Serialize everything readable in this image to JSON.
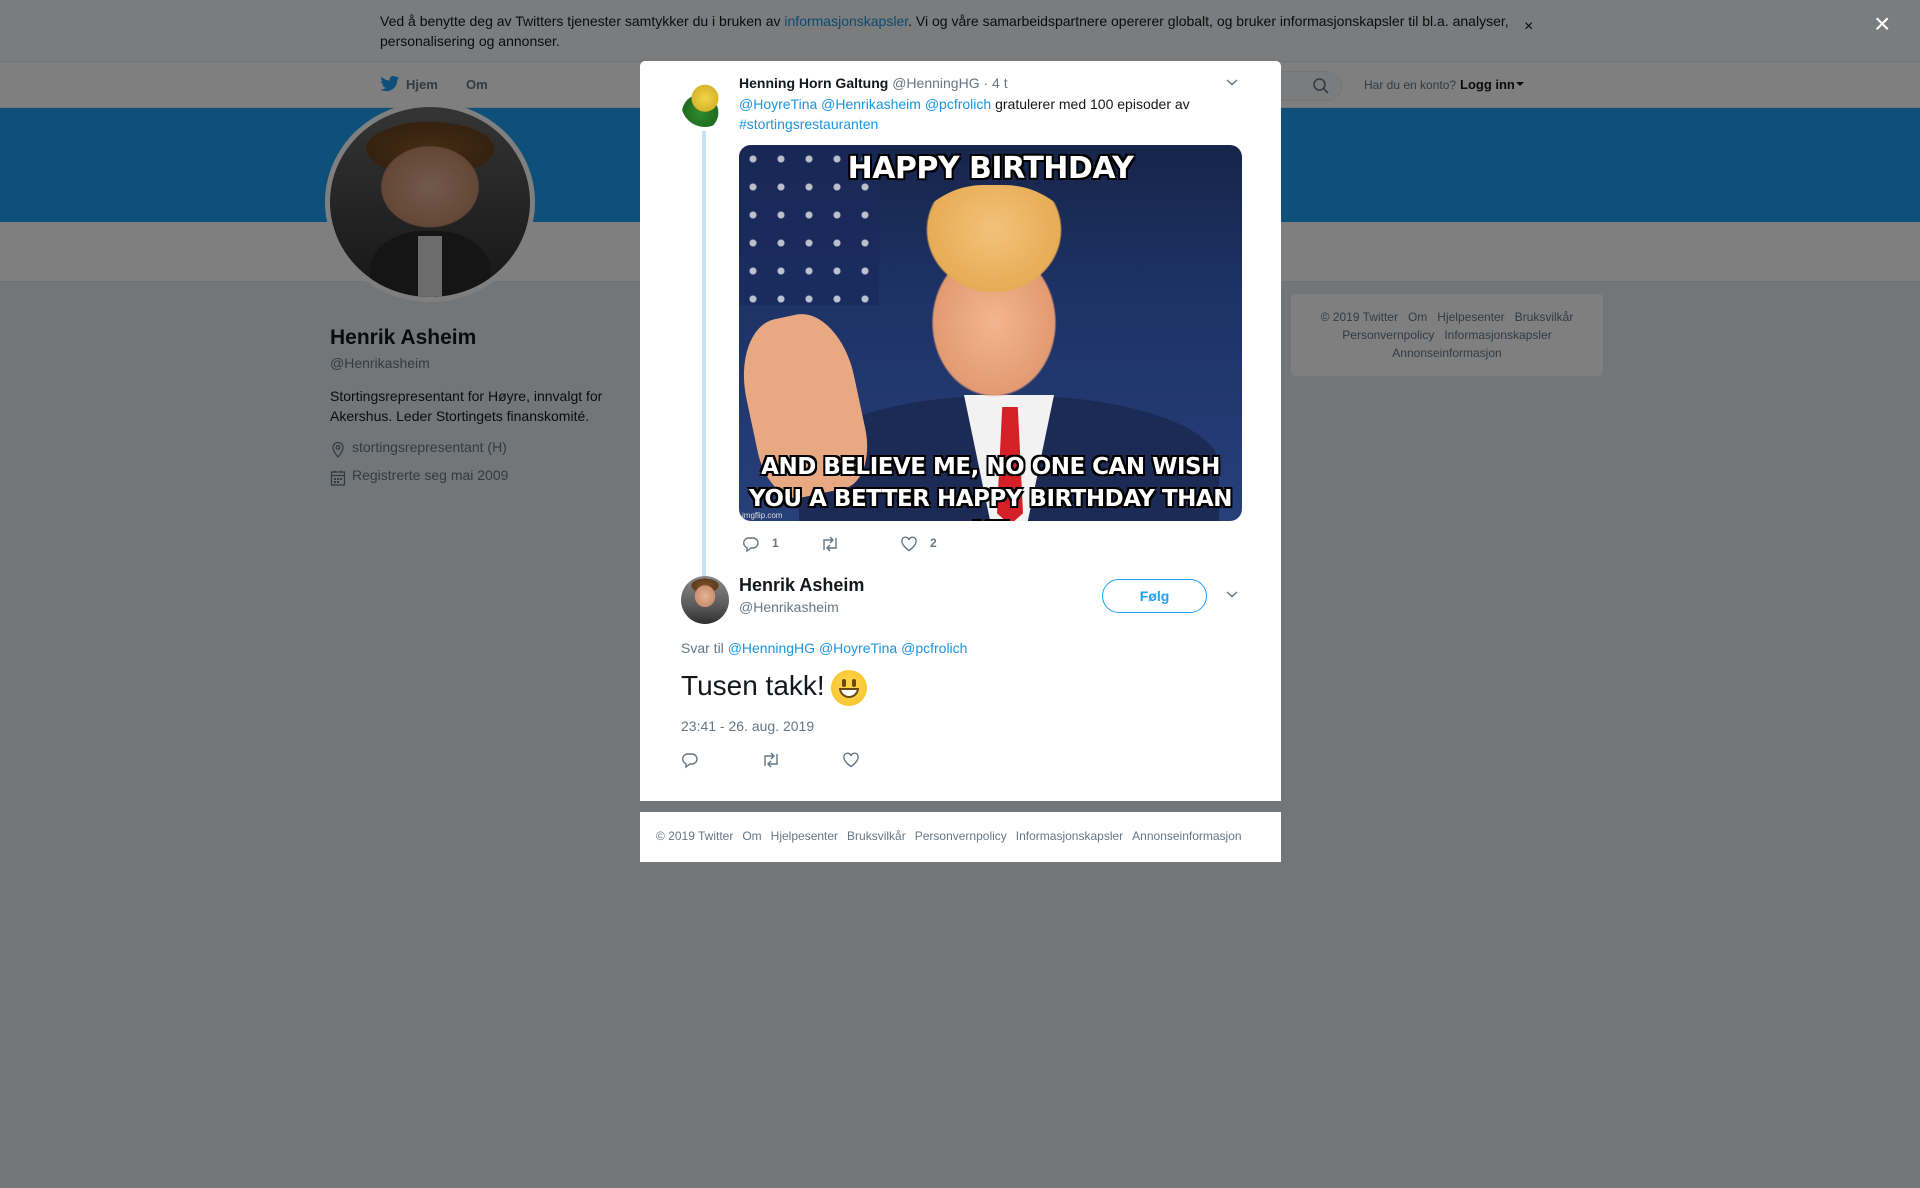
{
  "cookie_banner": {
    "text_before": "Ved å benytte deg av Twitters tjenester samtykker du i bruken av ",
    "link": "informasjonskapsler",
    "text_after": ". Vi og våre samarbeidspartnere opererer globalt, og bruker informasjonskapsler til bl.a. analyser, personalisering og annonser.",
    "close": "×"
  },
  "nav": {
    "home": "Hjem",
    "about": "Om",
    "login_question": "Har du en konto?",
    "login": "Logg inn"
  },
  "profile": {
    "name": "Henrik Asheim",
    "handle": "@Henrikasheim",
    "bio": "Stortingsrepresentant for Høyre, innvalgt for Akershus. Leder Stortingets finanskomité.",
    "location": "stortingsrepresentant (H)",
    "joined": "Registrerte seg mai 2009"
  },
  "sidebar_footer": [
    "© 2019 Twitter",
    "Om",
    "Hjelpesenter",
    "Bruksvilkår",
    "Personvernpolicy",
    "Informasjonskapsler",
    "Annonseinformasjon"
  ],
  "overlay_close": "×",
  "context_tweet": {
    "author_name": "Henning Horn Galtung",
    "author_handle": "@HenningHG",
    "time": "· 4 t",
    "mentions": "@HoyreTina @Henrikasheim @pcfrolich",
    "text": " gratulerer med 100 episoder av ",
    "hashtag": "#stortingsrestauranten",
    "meme_top": "HAPPY BIRTHDAY",
    "meme_bottom_1": "AND BELIEVE ME, NO ONE CAN WISH",
    "meme_bottom_2": "YOU A BETTER HAPPY BIRTHDAY THAN ME",
    "meme_watermark": "imgflip.com",
    "reply_count": "1",
    "like_count": "2"
  },
  "main_tweet": {
    "author_name": "Henrik Asheim",
    "author_handle": "@Henrikasheim",
    "follow_label": "Følg",
    "reply_to_prefix": "Svar til ",
    "reply_to_handles": "@HenningHG @HoyreTina @pcfrolich",
    "text": "Tusen takk!",
    "timestamp": "23:41 - 26. aug. 2019"
  },
  "modal_footer": [
    "© 2019 Twitter",
    "Om",
    "Hjelpesenter",
    "Bruksvilkår",
    "Personvernpolicy",
    "Informasjonskapsler",
    "Annonseinformasjon"
  ],
  "colors": {
    "accent": "#1da1f2",
    "link": "#1b95e0",
    "muted": "#657786",
    "overlay": "rgba(0,0,0,0.5)"
  }
}
